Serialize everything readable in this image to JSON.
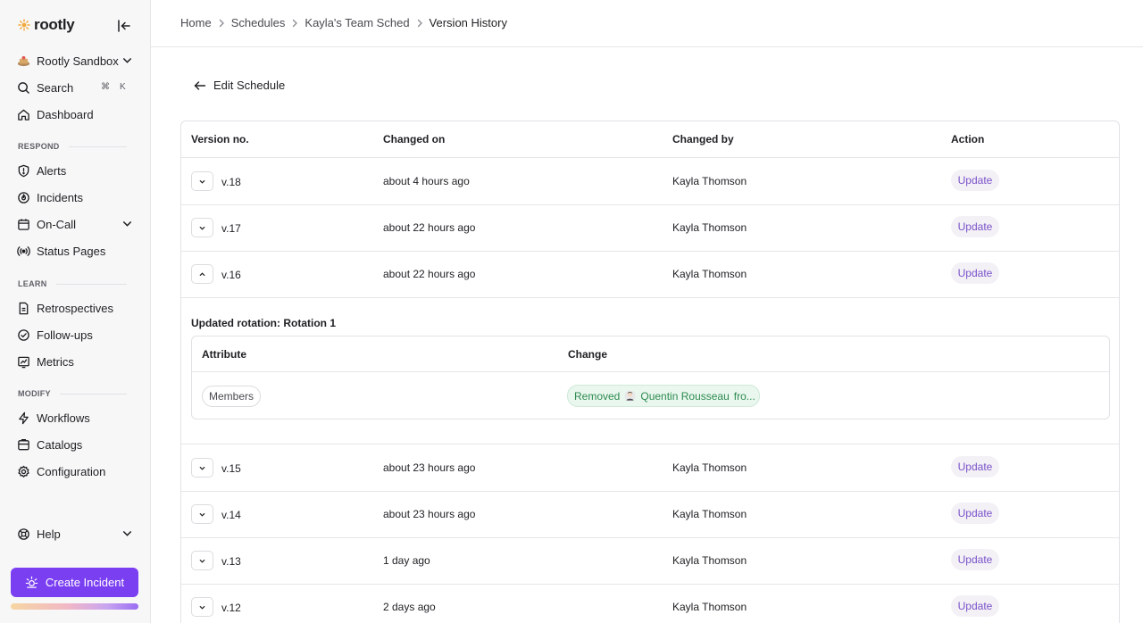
{
  "sidebar": {
    "logo_text": "rootly",
    "org": "Rootly Sandbox",
    "search": {
      "label": "Search",
      "shortcut_cmd": "⌘",
      "shortcut_key": "K"
    },
    "dashboard": "Dashboard",
    "sections": {
      "respond": "RESPOND",
      "learn": "LEARN",
      "modify": "MODIFY"
    },
    "respond_items": [
      "Alerts",
      "Incidents",
      "On-Call",
      "Status Pages"
    ],
    "learn_items": [
      "Retrospectives",
      "Follow-ups",
      "Metrics"
    ],
    "modify_items": [
      "Workflows",
      "Catalogs",
      "Configuration"
    ],
    "help": "Help",
    "create_incident": "Create Incident"
  },
  "breadcrumb": [
    "Home",
    "Schedules",
    "Kayla's Team Sched",
    "Version History"
  ],
  "back_label": "Edit Schedule",
  "table": {
    "headers": {
      "version": "Version no.",
      "changed_on": "Changed on",
      "changed_by": "Changed by",
      "action": "Action"
    },
    "action_label": "Update",
    "rows": [
      {
        "version": "v.18",
        "changed_on": "about 4 hours ago",
        "changed_by": "Kayla Thomson"
      },
      {
        "version": "v.17",
        "changed_on": "about 22 hours ago",
        "changed_by": "Kayla Thomson"
      },
      {
        "version": "v.16",
        "changed_on": "about 22 hours ago",
        "changed_by": "Kayla Thomson"
      },
      {
        "version": "v.15",
        "changed_on": "about 23 hours ago",
        "changed_by": "Kayla Thomson"
      },
      {
        "version": "v.14",
        "changed_on": "about 23 hours ago",
        "changed_by": "Kayla Thomson"
      },
      {
        "version": "v.13",
        "changed_on": "1 day ago",
        "changed_by": "Kayla Thomson"
      },
      {
        "version": "v.12",
        "changed_on": "2 days ago",
        "changed_by": "Kayla Thomson"
      }
    ],
    "expanded": {
      "title": "Updated rotation: Rotation 1",
      "headers": {
        "attribute": "Attribute",
        "change": "Change"
      },
      "attribute": "Members",
      "change_action": "Removed",
      "change_person": "Quentin Rousseau",
      "change_rest": "fro..."
    }
  },
  "colors": {
    "accent": "#7b3ff2",
    "update_text": "#7a52c9",
    "removed_text": "#2e8a50"
  }
}
